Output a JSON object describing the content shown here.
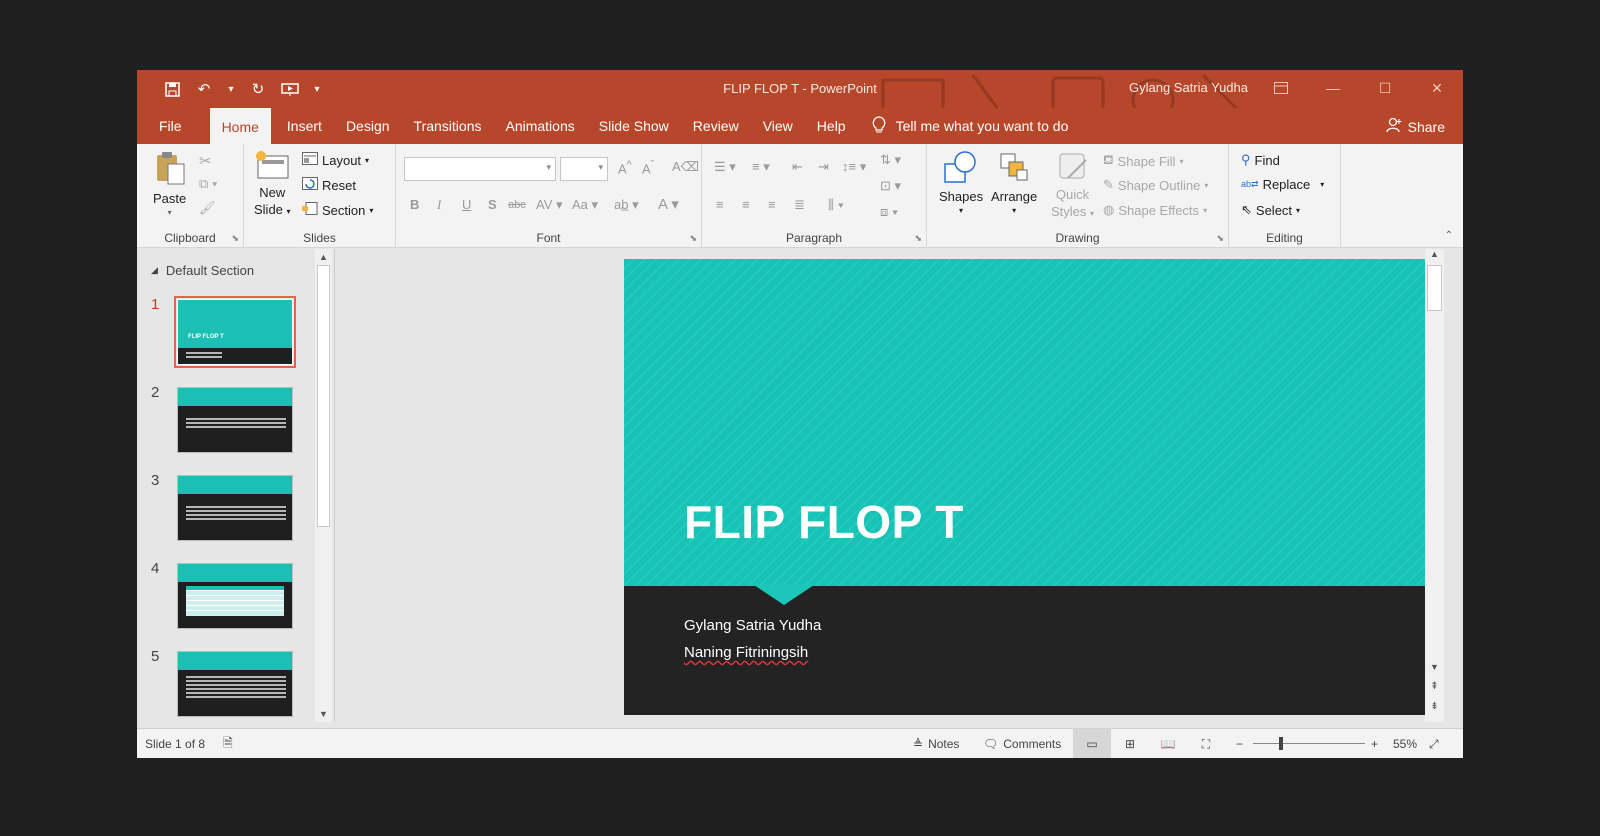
{
  "window": {
    "title": "FLIP FLOP T  -  PowerPoint",
    "user": "Gylang Satria Yudha"
  },
  "tabs": [
    "File",
    "Home",
    "Insert",
    "Design",
    "Transitions",
    "Animations",
    "Slide Show",
    "Review",
    "View",
    "Help"
  ],
  "tell_me": "Tell me what you want to do",
  "share_label": "Share",
  "ribbon": {
    "clipboard": {
      "label": "Clipboard",
      "paste": "Paste"
    },
    "slides": {
      "label": "Slides",
      "new_slide_1": "New",
      "new_slide_2": "Slide",
      "layout": "Layout",
      "reset": "Reset",
      "section": "Section"
    },
    "font": {
      "label": "Font",
      "bold": "B",
      "italic": "I",
      "underline": "U",
      "shadow": "S",
      "strike": "abc",
      "spacing": "AV",
      "case": "Aa"
    },
    "paragraph": {
      "label": "Paragraph"
    },
    "drawing": {
      "label": "Drawing",
      "shapes": "Shapes",
      "arrange": "Arrange",
      "quick_1": "Quick",
      "quick_2": "Styles",
      "shape_fill": "Shape Fill",
      "shape_outline": "Shape Outline",
      "shape_effects": "Shape Effects"
    },
    "editing": {
      "label": "Editing",
      "find": "Find",
      "replace": "Replace",
      "select": "Select"
    }
  },
  "thumbnails": {
    "section": "Default Section",
    "numbers": [
      "1",
      "2",
      "3",
      "4",
      "5"
    ]
  },
  "slide": {
    "title": "FLIP FLOP T",
    "author1": "Gylang Satria Yudha",
    "author2": "Naning Fitriningsih"
  },
  "status": {
    "slide_of": "Slide 1 of 8",
    "notes": "Notes",
    "comments": "Comments",
    "zoom": "55%"
  },
  "colors": {
    "accent": "#b7472a",
    "teal": "#18c2b5",
    "slide_dark": "#232323"
  }
}
